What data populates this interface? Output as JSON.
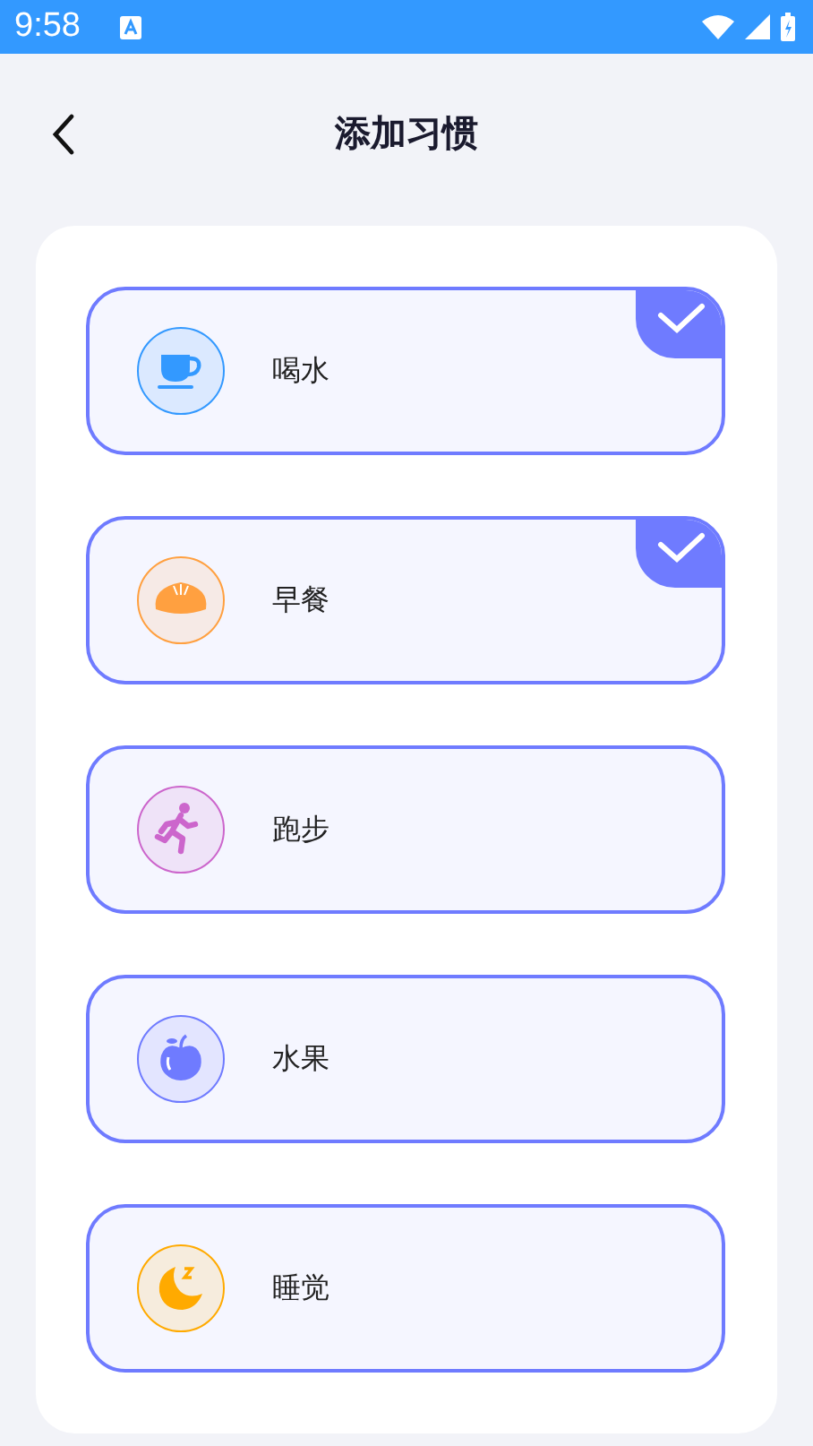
{
  "status_bar": {
    "time": "9:58"
  },
  "header": {
    "title": "添加习惯"
  },
  "habits": [
    {
      "label": "喝水",
      "kind": "cup",
      "color": "#3399ff",
      "selected": true
    },
    {
      "label": "早餐",
      "kind": "bun",
      "color": "#ffa040",
      "selected": true
    },
    {
      "label": "跑步",
      "kind": "runner",
      "color": "#cc66cc",
      "selected": false
    },
    {
      "label": "水果",
      "kind": "apple",
      "color": "#6f7bff",
      "selected": false
    },
    {
      "label": "睡觉",
      "kind": "moon",
      "color": "#ffaa00",
      "selected": false
    }
  ]
}
